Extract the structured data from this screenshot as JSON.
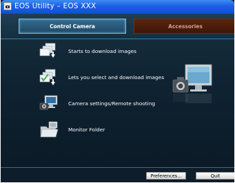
{
  "window": {
    "title": "EOS Utility – EOS XXX"
  },
  "tabs": [
    {
      "label": "Control Camera",
      "active": true
    },
    {
      "label": "Accessories",
      "active": false
    }
  ],
  "menu": {
    "items": [
      {
        "label": "Starts to download images",
        "icon": "download-images-icon"
      },
      {
        "label": "Lets you select and download images",
        "icon": "select-download-icon"
      },
      {
        "label": "Camera settings/Remote shooting",
        "icon": "remote-shooting-icon"
      },
      {
        "label": "Monitor Folder",
        "icon": "monitor-folder-icon"
      }
    ]
  },
  "buttons": {
    "preferences": "Preferences...",
    "quit": "Quit"
  },
  "colors": {
    "titlebar": "#1c5fe4",
    "background": "#0f2332",
    "active_tab_border": "#7fb8da",
    "accessories_tab": "#4a1c0b"
  }
}
